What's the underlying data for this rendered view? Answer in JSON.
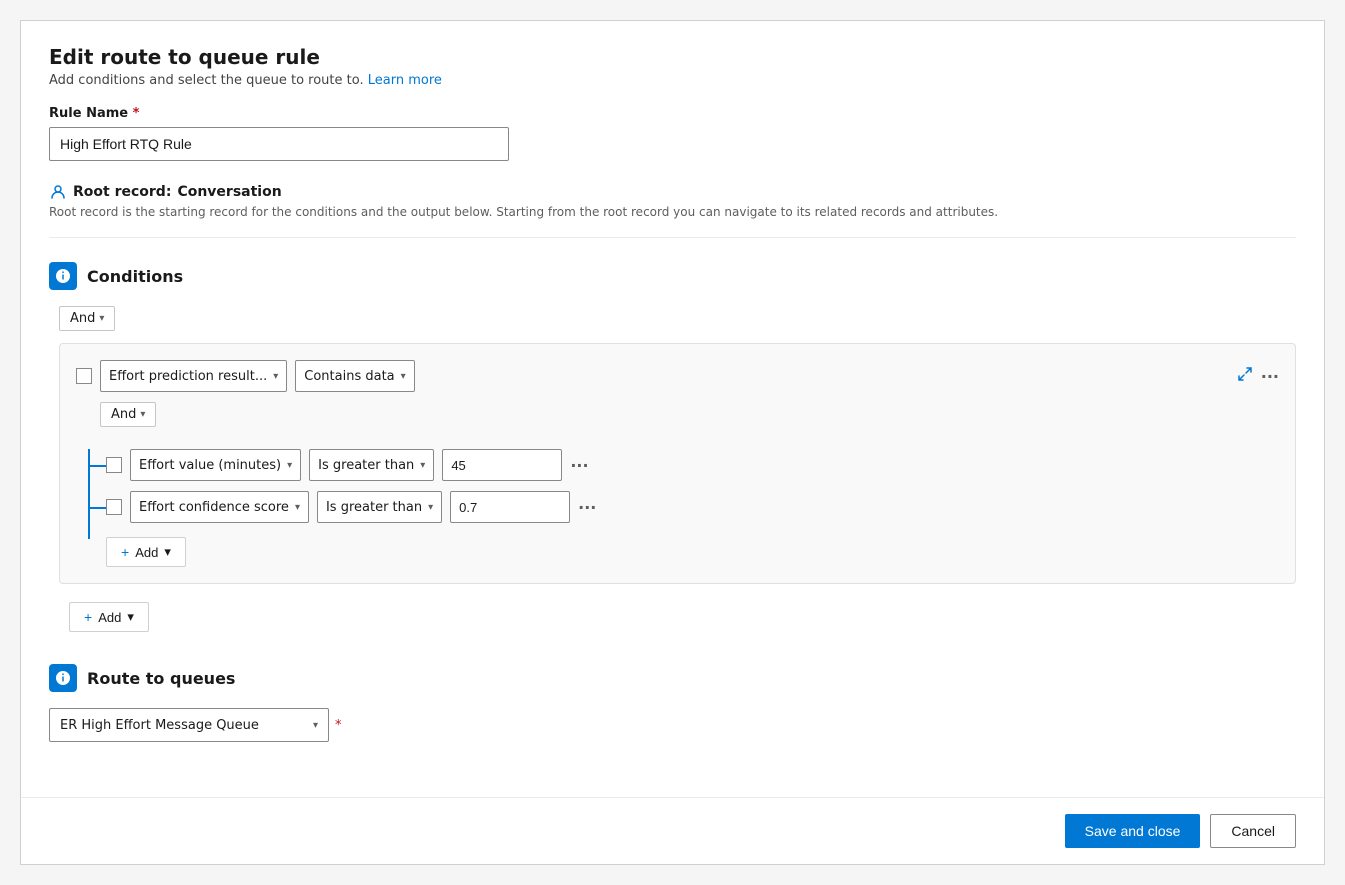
{
  "page": {
    "title": "Edit route to queue rule",
    "subtitle": "Add conditions and select the queue to route to.",
    "learn_more": "Learn more"
  },
  "rule_name": {
    "label": "Rule Name",
    "required": "*",
    "value": "High Effort RTQ Rule"
  },
  "root_record": {
    "label": "Root record:",
    "value": "Conversation",
    "description": "Root record is the starting record for the conditions and the output below. Starting from the root record you can navigate to its related records and attributes."
  },
  "conditions_section": {
    "title": "Conditions",
    "and_label": "And",
    "condition_row1": {
      "field": "Effort prediction result...",
      "operator": "Contains data"
    },
    "inner_and_label": "And",
    "condition_row2": {
      "field": "Effort value (minutes)",
      "operator": "Is greater than",
      "value": "45"
    },
    "condition_row3": {
      "field": "Effort confidence score",
      "operator": "Is greater than",
      "value": "0.7"
    },
    "add_label": "+ Add",
    "outer_add_label": "+ Add"
  },
  "route_to_queues_section": {
    "title": "Route to queues",
    "queue_value": "ER High Effort Message Queue",
    "required_star": "*"
  },
  "footer": {
    "save_label": "Save and close",
    "cancel_label": "Cancel"
  }
}
